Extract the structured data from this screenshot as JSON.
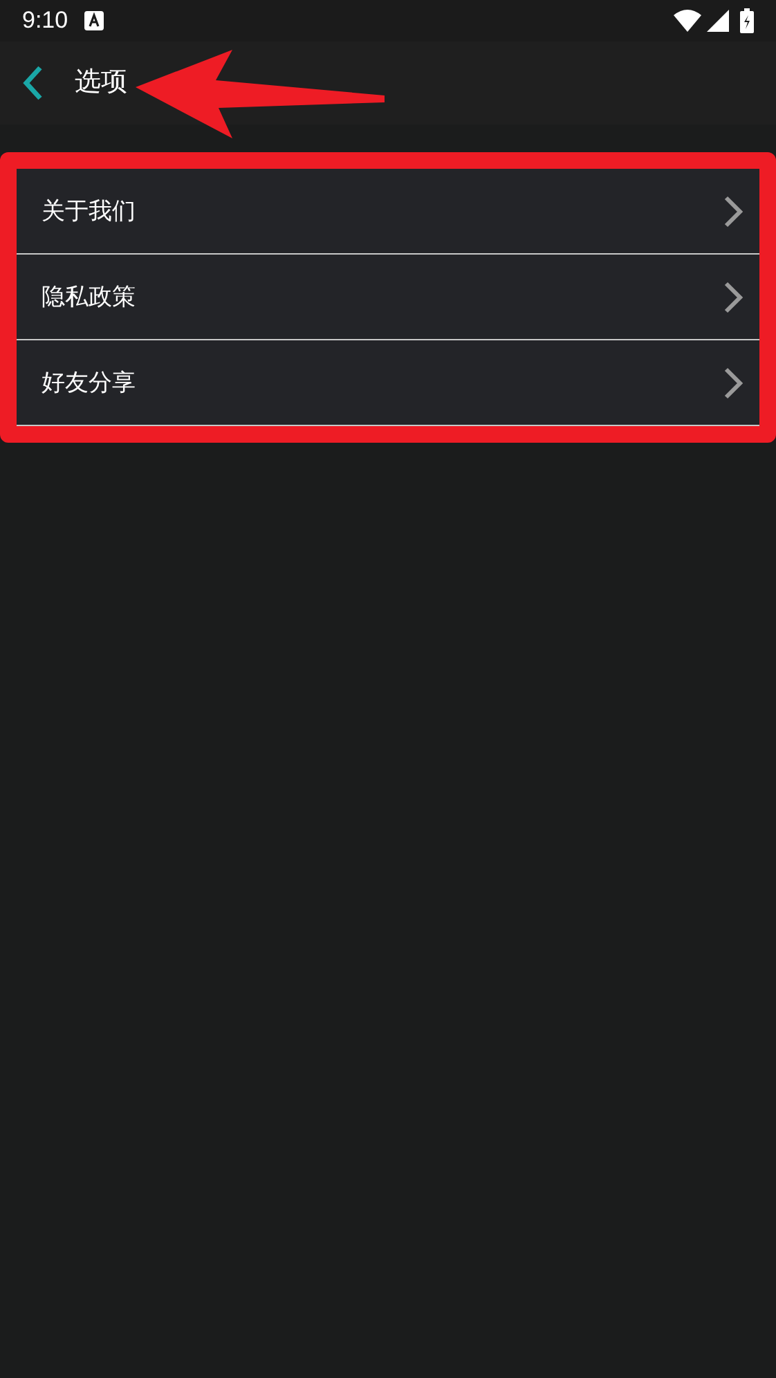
{
  "status_bar": {
    "time": "9:10"
  },
  "top_bar": {
    "title": "选项"
  },
  "menu": {
    "items": [
      {
        "label": "关于我们"
      },
      {
        "label": "隐私政策"
      },
      {
        "label": "好友分享"
      }
    ]
  }
}
